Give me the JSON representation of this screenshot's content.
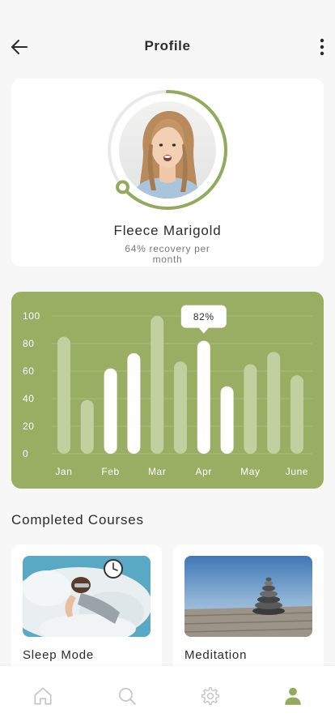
{
  "header": {
    "title": "Profile",
    "back_icon": "arrow-left-icon",
    "more_icon": "more-vertical-icon"
  },
  "profile": {
    "name": "Fleece Marigold",
    "subtitle": "64% recovery per month",
    "recovery_fraction": 0.64,
    "accent": "#93a95c"
  },
  "chart_data": {
    "type": "bar",
    "categories": [
      "Jan",
      "",
      "Feb",
      "",
      "Mar",
      "",
      "Apr",
      "",
      "May",
      "",
      "June"
    ],
    "x_tick_labels": [
      "Jan",
      "Feb",
      "Mar",
      "Apr",
      "May",
      "June"
    ],
    "values": [
      85,
      39,
      62,
      73,
      100,
      67,
      82,
      49,
      65,
      74,
      57
    ],
    "highlighted": [
      false,
      false,
      true,
      true,
      false,
      false,
      true,
      true,
      false,
      false,
      false
    ],
    "ylim": [
      0,
      100
    ],
    "yticks": [
      0,
      20,
      40,
      60,
      80,
      100
    ],
    "tooltip": {
      "index": 6,
      "label": "82%"
    },
    "grid": true,
    "background": "#99ad63",
    "bar_color": "#ffffff",
    "bar_muted_color": "#c2d0a0"
  },
  "courses": {
    "title": "Completed Courses",
    "items": [
      {
        "label": "Sleep Mode"
      },
      {
        "label": "Meditation"
      }
    ]
  },
  "nav": {
    "items": [
      {
        "icon": "home-icon",
        "active": false
      },
      {
        "icon": "search-icon",
        "active": false
      },
      {
        "icon": "gear-icon",
        "active": false
      },
      {
        "icon": "user-icon",
        "active": true
      }
    ],
    "active_color": "#93a95c",
    "inactive_color": "#c7c7c7"
  }
}
